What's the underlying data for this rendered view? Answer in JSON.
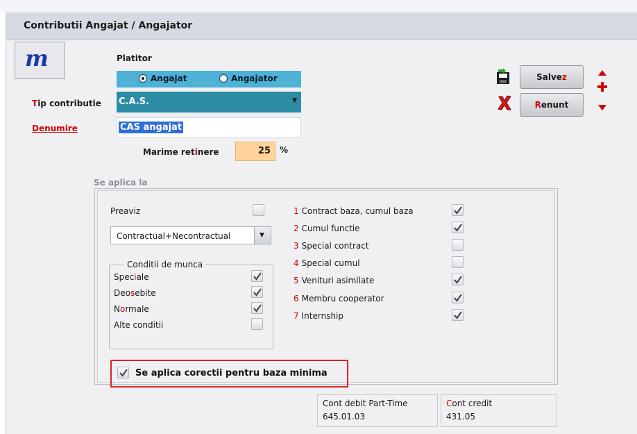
{
  "window": {
    "title": "Contributii Angajat / Angajator"
  },
  "platitor": {
    "label": "Platitor",
    "options": [
      {
        "label": "Angajat",
        "selected": true
      },
      {
        "label": "Angajator",
        "selected": false
      }
    ]
  },
  "tip_contributie": {
    "label_first": "T",
    "label_rest": "ip contributie",
    "value": "C.A.S."
  },
  "denumire": {
    "label": "Denumire",
    "value": "CAS angajat"
  },
  "marime": {
    "label_a": "Marime ret",
    "label_hot": "i",
    "label_b": "nere",
    "value": "25",
    "unit": "%"
  },
  "buttons": {
    "save_a": "Salve",
    "save_hot": "z",
    "cancel_hot": "R",
    "cancel_b": "enunt"
  },
  "section": {
    "title": "Se aplica la",
    "preaviz_label": "Preaviz",
    "preaviz_checked": false,
    "dropdown_value": "Contractual+Necontractual",
    "conditii_title": "Conditii de munca",
    "conditii": [
      {
        "a": "Spec",
        "hot": "i",
        "b": "ale",
        "checked": true
      },
      {
        "a": "Deo",
        "hot": "s",
        "b": "ebite",
        "checked": true
      },
      {
        "a": "N",
        "hot": "o",
        "b": "rmale",
        "checked": true
      },
      {
        "a": "Alte conditii",
        "hot": "",
        "b": "",
        "checked": false
      }
    ],
    "contracte": [
      {
        "num": "1",
        "label": "Contract baza, cumul baza",
        "checked": true
      },
      {
        "num": "2",
        "label": "Cumul functie",
        "checked": true
      },
      {
        "num": "3",
        "label": "Special contract",
        "checked": false
      },
      {
        "num": "4",
        "label": "Special cumul",
        "checked": false
      },
      {
        "num": "5",
        "label": "Venituri asimilate",
        "checked": true
      },
      {
        "num": "6",
        "label": "Membru cooperator",
        "checked": true
      },
      {
        "num": "7",
        "label": "Internship",
        "checked": true
      }
    ],
    "corectii_label": "Se aplica corectii pentru baza minima",
    "corectii_checked": true
  },
  "conturi": {
    "debit_label": "Cont debit Part-Time",
    "debit_value": "645.01.03",
    "credit_hot": "C",
    "credit_rest": "ont credit",
    "credit_value": "431.05"
  },
  "colors": {
    "accent": "#4db2d6",
    "select_bg": "#2b8ca4",
    "highlight_red": "#d40000",
    "value_bg": "#ffd39a"
  },
  "icons": [
    "logo-m-icon",
    "save-floppy-icon",
    "cancel-x-icon",
    "arrow-up-icon",
    "plus-icon",
    "arrow-down-icon",
    "check-icon"
  ]
}
